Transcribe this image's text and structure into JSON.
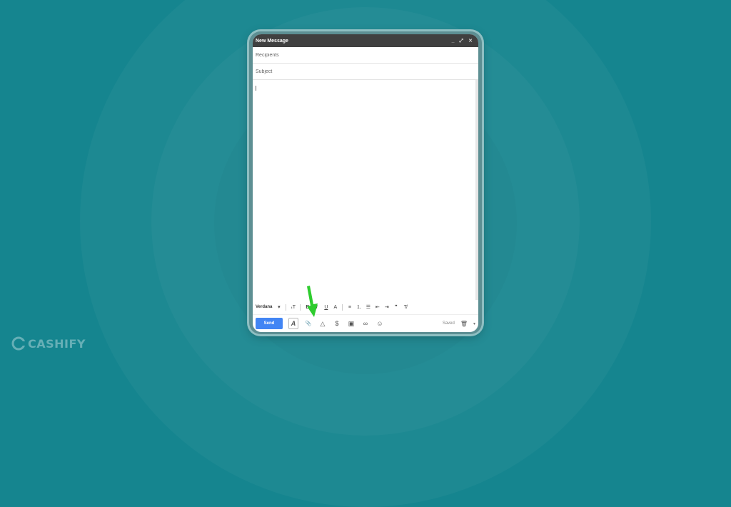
{
  "window": {
    "title": "New Message",
    "controls": {
      "minimize": "_",
      "maximize": "⤢",
      "close": "✕"
    }
  },
  "compose": {
    "recipients_placeholder": "Recipients",
    "subject_placeholder": "Subject"
  },
  "format_bar": {
    "font": "Verdana",
    "size_icon": "ₜT",
    "bold": "B",
    "italic": "I",
    "underline": "U",
    "text_color": "A",
    "align": "≡",
    "numbered_list": "⒈",
    "bulleted_list": "☰",
    "indent_less": "⇤",
    "indent_more": "⇥",
    "quote": "❞",
    "clear_format": "T̸"
  },
  "bottom_bar": {
    "send_label": "Send",
    "formatting_icon": "A",
    "attach_icon": "📎",
    "drive_icon": "△",
    "money_icon": "$",
    "photo_icon": "▣",
    "link_icon": "∞",
    "emoji_icon": "☺",
    "status": "Saved",
    "trash_icon": "🗑",
    "more_icon": "▾"
  },
  "annotation": {
    "arrow_color": "#2ecc2e"
  },
  "brand": {
    "name": "CASHIFY"
  },
  "colors": {
    "background": "#15858f",
    "send_button": "#4285f4",
    "titlebar": "#404040"
  }
}
